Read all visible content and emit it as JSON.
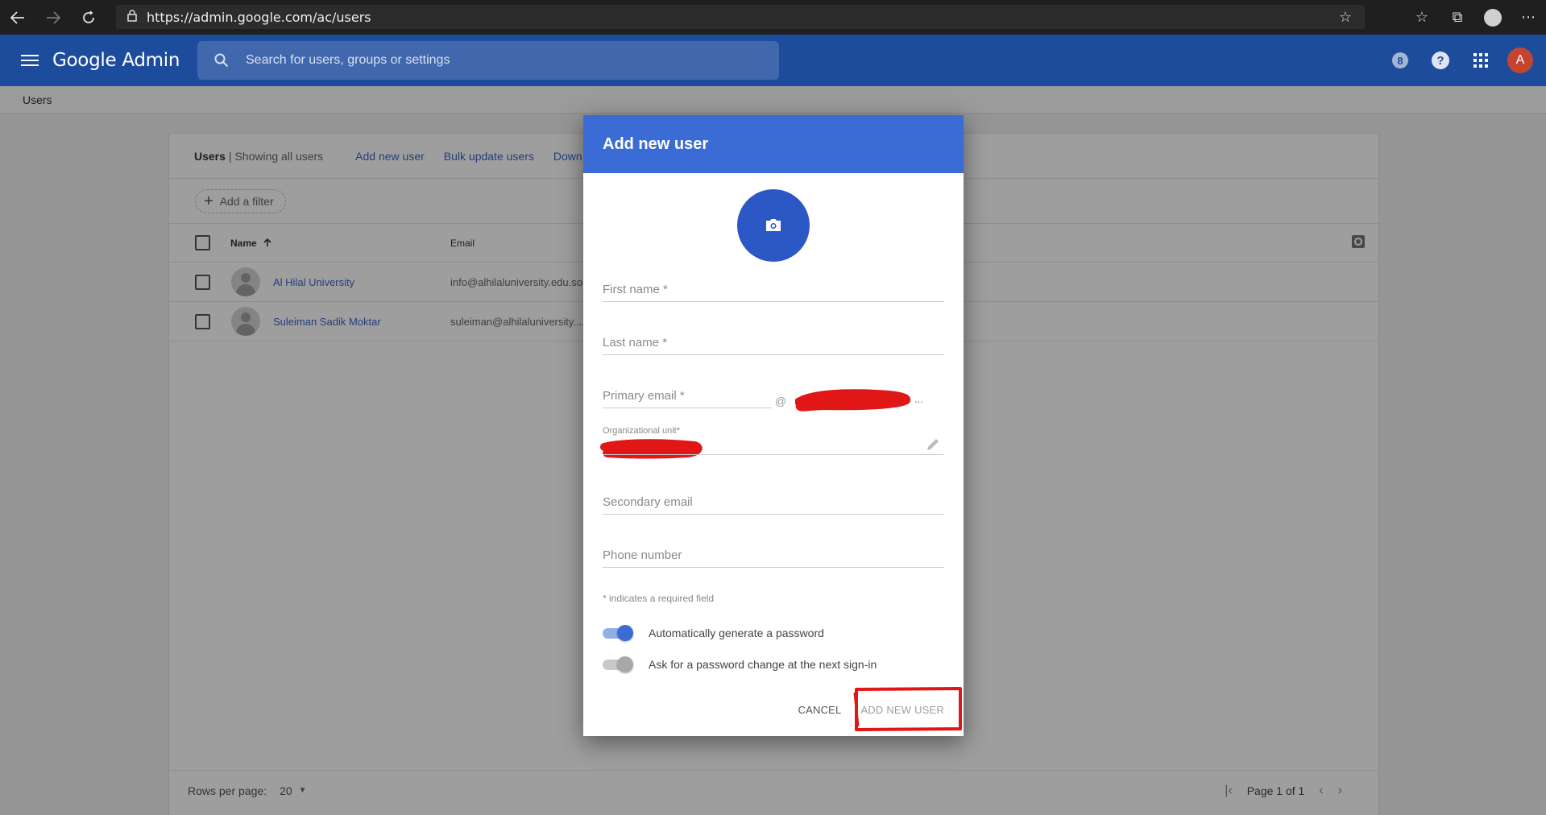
{
  "browser": {
    "url": "https://admin.google.com/ac/users"
  },
  "header": {
    "brand": "Google Admin",
    "search_placeholder": "Search for users, groups or settings",
    "badge_count": "8",
    "help_label": "?",
    "avatar_letter": "A"
  },
  "breadcrumb": "Users",
  "users_card": {
    "title": "Users",
    "subtitle": "| Showing all users",
    "links": [
      "Add new user",
      "Bulk update users",
      "Down"
    ],
    "filter_label": "Add a filter",
    "columns": {
      "name": "Name",
      "email": "Email"
    },
    "rows": [
      {
        "name": "Al Hilal University",
        "email": "info@alhilaluniversity.edu.so"
      },
      {
        "name": "Suleiman Sadik Moktar",
        "email": "suleiman@alhilaluniversity...."
      }
    ],
    "rows_per_page_label": "Rows per page:",
    "rows_per_page_value": "20",
    "page_text": "Page 1 of 1"
  },
  "dialog": {
    "title": "Add new user",
    "first_name_placeholder": "First name *",
    "last_name_placeholder": "Last name *",
    "primary_email_placeholder": "Primary email *",
    "at_sign": "@",
    "domain_ellipsis": "...",
    "org_unit_label": "Organizational unit*",
    "secondary_email_placeholder": "Secondary email",
    "phone_placeholder": "Phone number",
    "required_note": "* indicates a required field",
    "toggles": [
      {
        "label": "Automatically generate a password",
        "on": true
      },
      {
        "label": "Ask for a password change at the next sign-in",
        "on": false
      }
    ],
    "cancel_label": "CANCEL",
    "add_label": "ADD NEW USER"
  },
  "colors": {
    "header_blue": "#1e4c9c",
    "dialog_blue": "#3b6bd4",
    "annotation_red": "#e11616"
  }
}
